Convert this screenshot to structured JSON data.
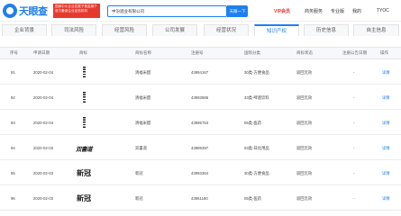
{
  "header": {
    "brand": "天眼查",
    "promo_text": "国家中小企业发展子基金旗下 官方备案企业征信机构",
    "search_value": "中汾酒业有限公司",
    "search_button": "天眼一下",
    "nav": [
      "VIP会员",
      "商务服务",
      "专业版",
      "我的",
      "TYOC"
    ]
  },
  "tabs": [
    "企业背景",
    "司法风险",
    "经营风险",
    "公司发展",
    "经营状况",
    "知识产权",
    "历史信息",
    "自主信息"
  ],
  "active_tab": "知识产权",
  "table": {
    "headers": [
      "序号",
      "申请日期",
      "商标",
      "商标名称",
      "注册号",
      "国际分类",
      "商标状态",
      "注册公告日期",
      "操作"
    ],
    "rows": [
      {
        "no": "91",
        "date": "2020-02-04",
        "img": "barcode",
        "img_text": "",
        "name": "清福米醋",
        "reg": "43994167",
        "cls": "30类-方便食品",
        "status": "驳回无效",
        "notice": "-",
        "op": "详情"
      },
      {
        "no": "92",
        "date": "2020-02-04",
        "img": "barcode",
        "img_text": "",
        "name": "清福米醋",
        "reg": "43993986",
        "cls": "33类-啤酒饮料",
        "status": "驳回无效",
        "notice": "-",
        "op": "详情"
      },
      {
        "no": "93",
        "date": "2020-02-04",
        "img": "barcode",
        "img_text": "",
        "name": "清福米醋",
        "reg": "43995753",
        "cls": "05类-医药",
        "status": "驳回无效",
        "notice": "-",
        "op": "详情"
      },
      {
        "no": "94",
        "date": "2020-02-03",
        "img": "calligraphy",
        "img_text": "双書道",
        "name": "双書道",
        "reg": "43989397",
        "cls": "03类-日化用品",
        "status": "驳回无效",
        "notice": "-",
        "op": "详情"
      },
      {
        "no": "95",
        "date": "2020-02-03",
        "img": "calligraphy2",
        "img_text": "新冠",
        "name": "新冠",
        "reg": "43993364",
        "cls": "30类-方便食品",
        "status": "驳回无效",
        "notice": "-",
        "op": "详情"
      },
      {
        "no": "96",
        "date": "2020-02-03",
        "img": "calligraphy2",
        "img_text": "新冠",
        "name": "新冠",
        "reg": "43961180",
        "cls": "05类-医药",
        "status": "驳回无效",
        "notice": "-",
        "op": "详情"
      }
    ]
  },
  "colors": {
    "accent": "#1e7ff0",
    "promo": "#e8392f"
  }
}
